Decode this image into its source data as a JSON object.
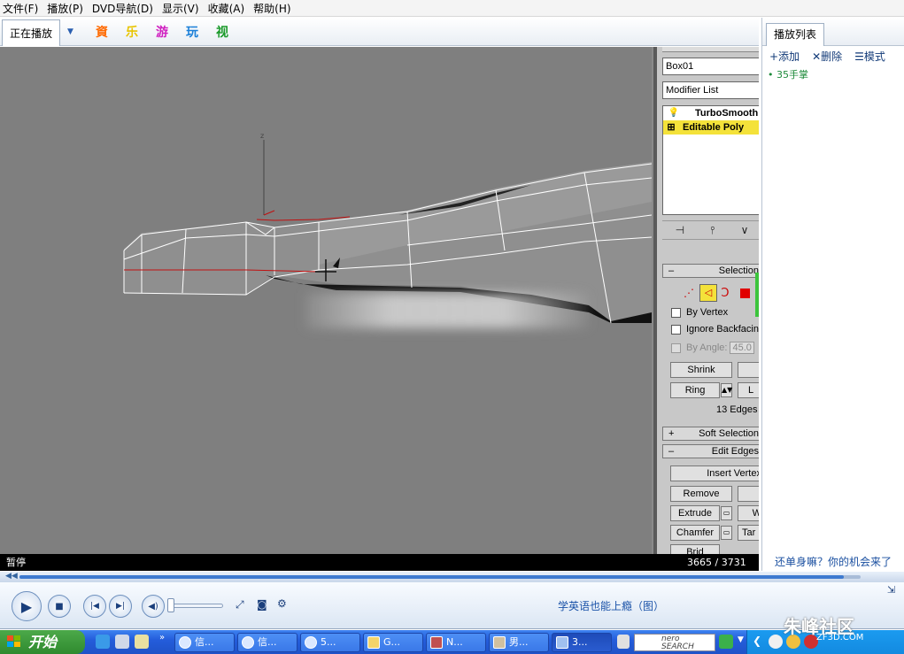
{
  "menu": [
    "文件(F)",
    "播放(P)",
    "DVD导航(D)",
    "显示(V)",
    "收藏(A)",
    "帮助(H)"
  ],
  "player_tabs": {
    "now_playing": "正在播放",
    "channels": [
      {
        "label": "資",
        "color": "#ff6a00"
      },
      {
        "label": "乐",
        "color": "#e8c400"
      },
      {
        "label": "游",
        "color": "#d01fc0"
      },
      {
        "label": "玩",
        "color": "#1a7fd8"
      },
      {
        "label": "视",
        "color": "#1a9a2a"
      }
    ]
  },
  "max_panel": {
    "object_name": "Box01",
    "modifier_list": "Modifier List",
    "stack": [
      "TurboSmooth",
      "Editable Poly"
    ],
    "selection_rollout": "Selection",
    "by_vertex": "By Vertex",
    "ignore_backfacing": "Ignore Backfacing",
    "by_angle": "By Angle:",
    "by_angle_value": "45.0",
    "shrink": "Shrink",
    "ring": "Ring",
    "loop_initial": "L",
    "edges_count": "13 Edges",
    "soft_selection": "Soft Selection",
    "edit_edges": "Edit Edges",
    "insert_vertex": "Insert Vertex",
    "remove": "Remove",
    "extrude": "Extrude",
    "weld_initial": "W",
    "chamfer": "Chamfer",
    "target_initial": "Tar",
    "bridge_partial": "Brid"
  },
  "status": {
    "state": "暂停",
    "frames": "3665 / 3731"
  },
  "playback": {
    "progress_fraction": 0.98,
    "volume_fraction": 0.05,
    "now_title": "学英语也能上瘾（图）"
  },
  "playlist": {
    "tab": "播放列表",
    "add": "+添加",
    "delete": "✕删除",
    "mode": "☰模式",
    "items": [
      "35手掌"
    ],
    "ad": "还单身嘛？你的机会来了"
  },
  "taskbar": {
    "start": "开始",
    "buttons": [
      "信...",
      "信...",
      "5...",
      "G...",
      "N...",
      "男...",
      "3..."
    ],
    "nero_label": "nero SEARCH"
  },
  "watermark": {
    "text": "朱峰社区",
    "sub": "ZF3D.COM"
  }
}
